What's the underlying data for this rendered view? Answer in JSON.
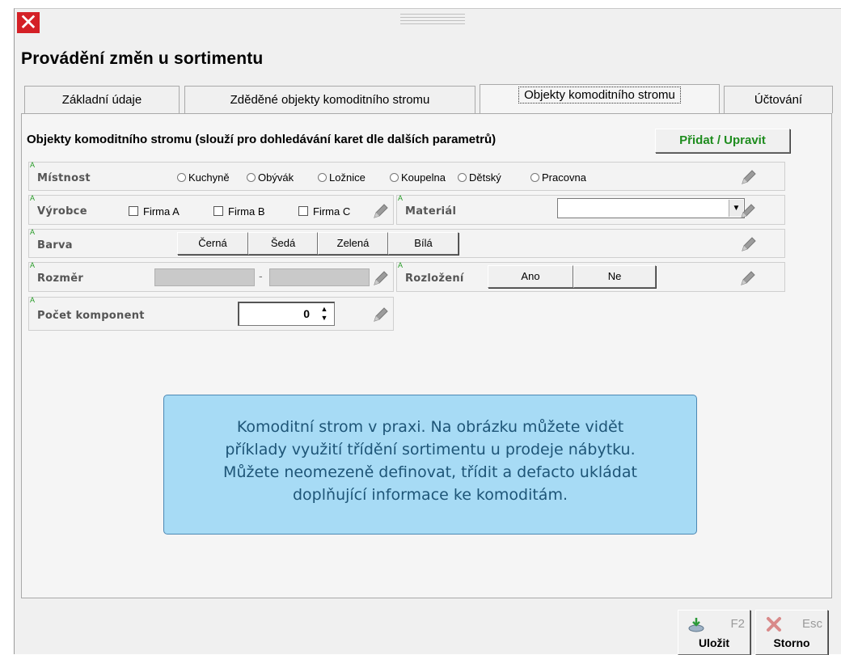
{
  "window": {
    "title": "Provádění změn u sortimentu",
    "close_symbol": "✕"
  },
  "tabs": [
    {
      "label": "Základní údaje",
      "active": false
    },
    {
      "label": "Zděděné objekty komoditního stromu",
      "active": false
    },
    {
      "label": "Objekty komoditního stromu",
      "active": true
    },
    {
      "label": "Účtování",
      "active": false
    }
  ],
  "panel": {
    "subtitle": "Objekty komoditního stromu (slouží pro dohledávání karet dle dalších parametrů)",
    "add_button_label": "Přidat / Upravit",
    "add_button_color": "#1e8c1e"
  },
  "attribute_marker": "A",
  "rows": {
    "mistnost": {
      "label": "Místnost",
      "options": [
        "Kuchyně",
        "Obývák",
        "Ložnice",
        "Koupelna",
        "Dětský",
        "Pracovna"
      ]
    },
    "vyrobce": {
      "label": "Výrobce",
      "options": [
        "Firma A",
        "Firma B",
        "Firma C"
      ]
    },
    "material": {
      "label": "Materiál",
      "value": ""
    },
    "barva": {
      "label": "Barva",
      "options": [
        "Černá",
        "Šedá",
        "Zelená",
        "Bílá"
      ]
    },
    "rozmer": {
      "label": "Rozměr",
      "separator": "-"
    },
    "rozlozeni": {
      "label": "Rozložení",
      "options": [
        "Ano",
        "Ne"
      ]
    },
    "pocet": {
      "label": "Počet komponent",
      "value": "0"
    }
  },
  "callout": {
    "lines": [
      "Komoditní strom v praxi. Na obrázku můžete vidět",
      "příklady využití třídění sortimentu u prodeje nábytku.",
      "Můžete neomezeně definovat, třídit a defacto ukládat",
      "doplňující informace ke komoditám."
    ]
  },
  "footer": {
    "save": {
      "label": "Uložit",
      "key": "F2",
      "icon": "save-disk-icon"
    },
    "cancel": {
      "label": "Storno",
      "key": "Esc",
      "icon": "cancel-x-icon"
    }
  }
}
